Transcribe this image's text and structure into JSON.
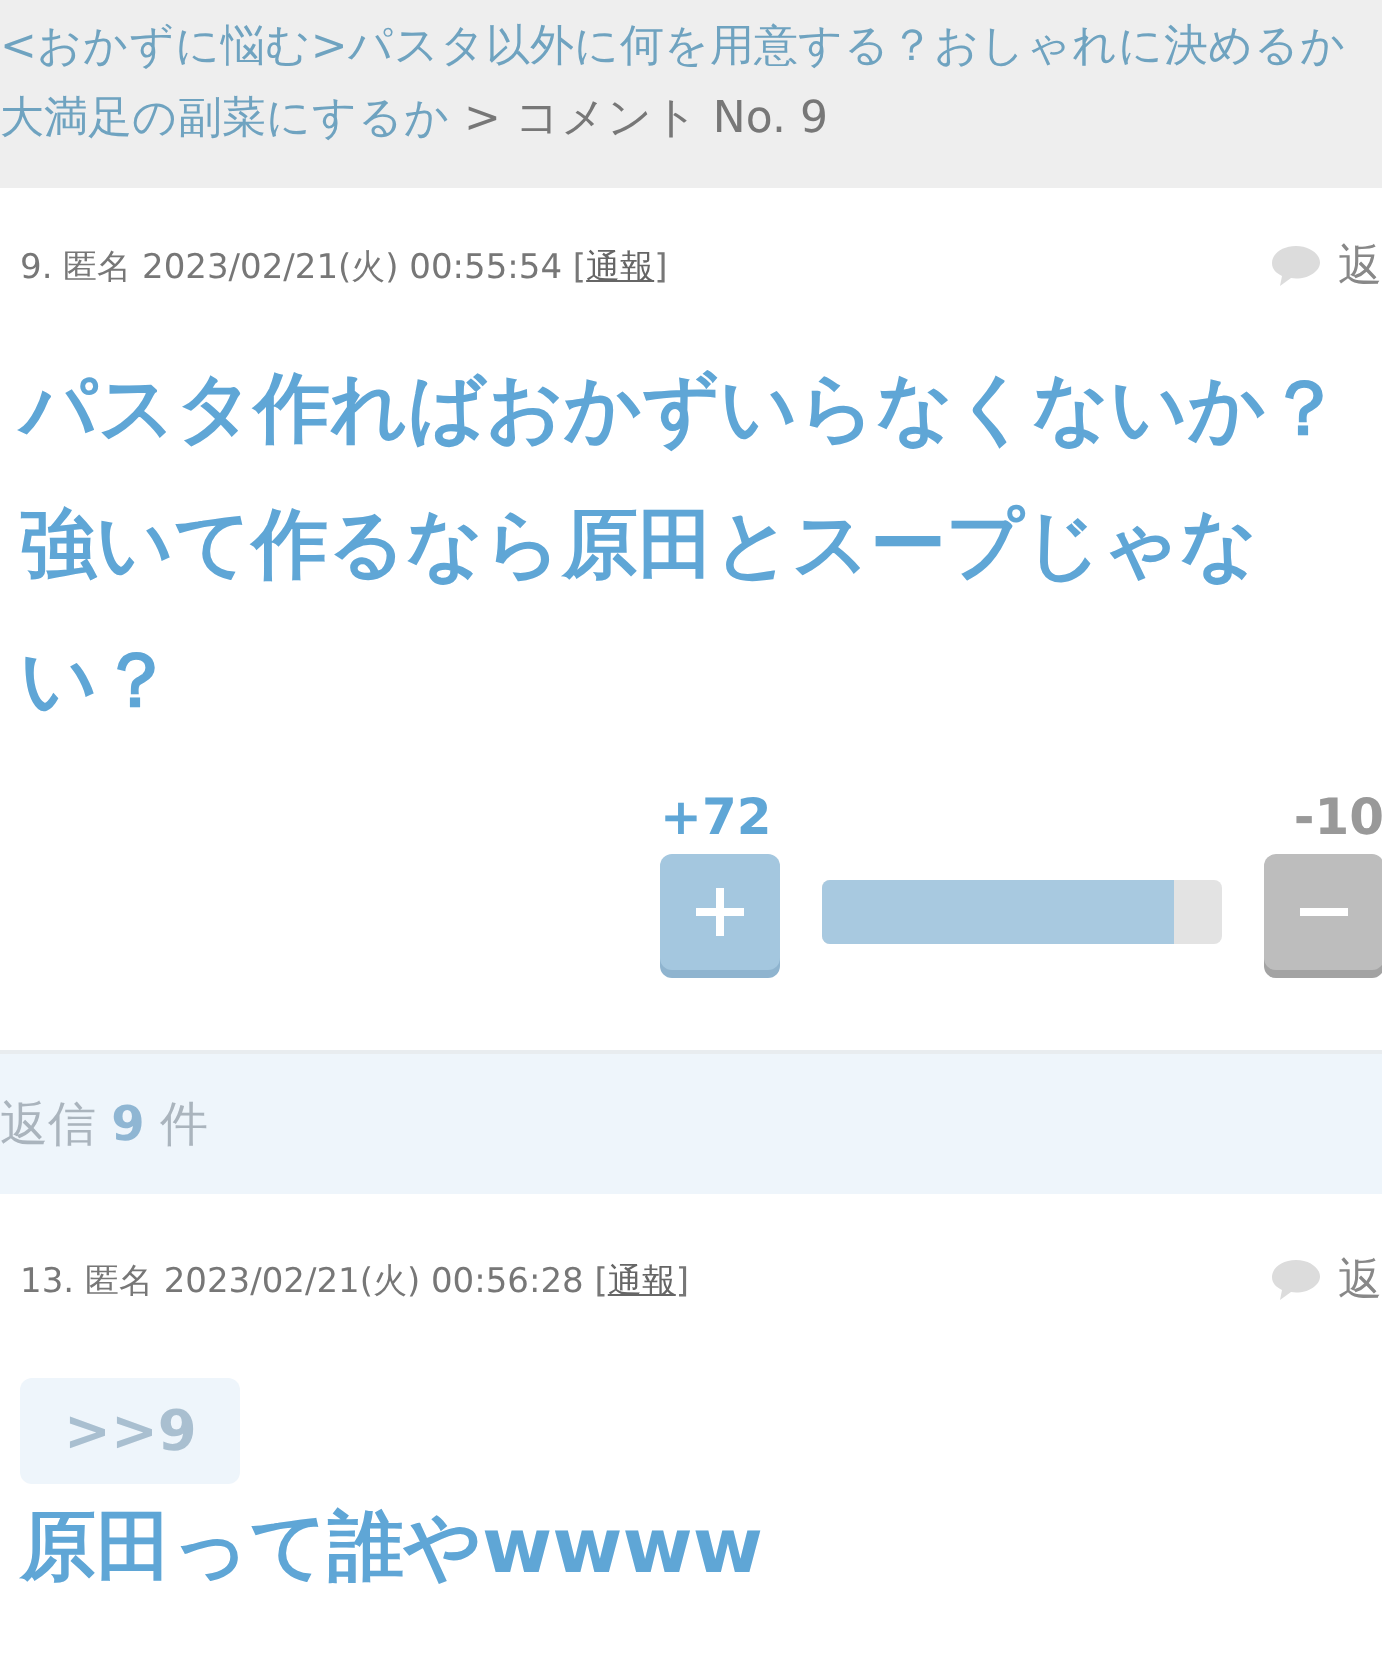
{
  "breadcrumb": {
    "topic_link": "<おかずに悩む>パスタ以外に何を用意する？おしゃれに決めるか大満足の副菜にするか",
    "separator": ">",
    "current": "コメント No. 9"
  },
  "comment": {
    "number": "9.",
    "author": "匿名",
    "date": "2023/02/21(火) 00:55:54",
    "bracket_open": "[",
    "report": "通報",
    "bracket_close": "]",
    "reply_label": "返",
    "body": "パスタ作ればおかずいらなくないか？強いて作るなら原田とスープじゃない？",
    "plus_count": "+72",
    "minus_count": "-10",
    "level": 0.88
  },
  "replies_bar": {
    "prefix": "返信",
    "count": "9",
    "suffix": "件"
  },
  "reply": {
    "number": "13.",
    "author": "匿名",
    "date": "2023/02/21(火) 00:56:28",
    "bracket_open": "[",
    "report": "通報",
    "bracket_close": "]",
    "reply_label": "返",
    "anchor": ">>9",
    "body": "原田って誰やwwww"
  }
}
